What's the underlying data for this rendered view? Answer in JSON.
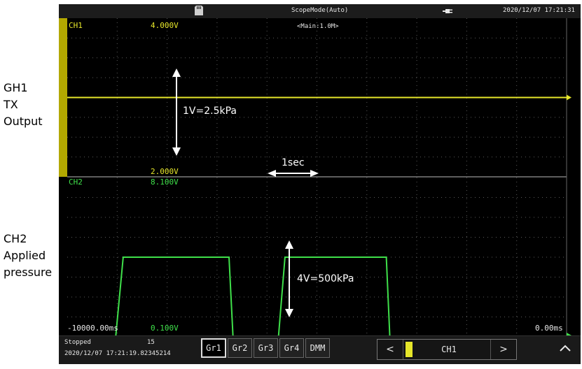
{
  "labels": {
    "ch1": [
      "GH1",
      "TX",
      "Output"
    ],
    "ch2": [
      "CH2",
      "Applied",
      "pressure"
    ]
  },
  "status": {
    "title": "ScopeMode(Auto)",
    "datetime": "2020/12/07 17:21:31",
    "icons": [
      "sd-card-icon",
      "power-plug-icon"
    ]
  },
  "ch1": {
    "name": "CH1",
    "top_value": "4.000V",
    "bottom_value": "2.000V",
    "timebase": "<Main:1.0M>",
    "color": "#e6e62a",
    "level_v": 3.0
  },
  "ch2": {
    "name": "CH2",
    "top_value": "8.100V",
    "bottom_value": "0.100V",
    "color": "#3fe04a",
    "low_v": 0.1,
    "high_v": 4.1
  },
  "time_axis": {
    "start": "-10000.00ms",
    "end": "0.00ms"
  },
  "annotations": {
    "ch1_scale": "1V=2.5kPa",
    "time_scale": "1sec",
    "ch2_scale": "4V=500kPa"
  },
  "bottom": {
    "state": "Stopped",
    "count": "15",
    "timestamp": "2020/12/07 17:21:19.82345214",
    "groups": [
      "Gr1",
      "Gr2",
      "Gr3",
      "Gr4",
      "DMM"
    ],
    "active_group": "Gr1",
    "channel_selected": "CH1",
    "prev": "<",
    "next": ">"
  },
  "chart_data": {
    "type": "line",
    "series": [
      {
        "name": "CH1",
        "x": [
          -10000,
          0
        ],
        "y": [
          3.0,
          3.0
        ]
      },
      {
        "name": "CH2",
        "x": [
          -9030,
          -8880,
          -8800,
          -6760,
          -6680,
          -5770,
          -5640,
          -5560,
          -3610,
          -3540,
          0
        ],
        "y": [
          0.1,
          4.1,
          4.1,
          4.1,
          0.1,
          0.1,
          4.1,
          4.1,
          4.1,
          0.1,
          0.1
        ]
      }
    ]
  }
}
